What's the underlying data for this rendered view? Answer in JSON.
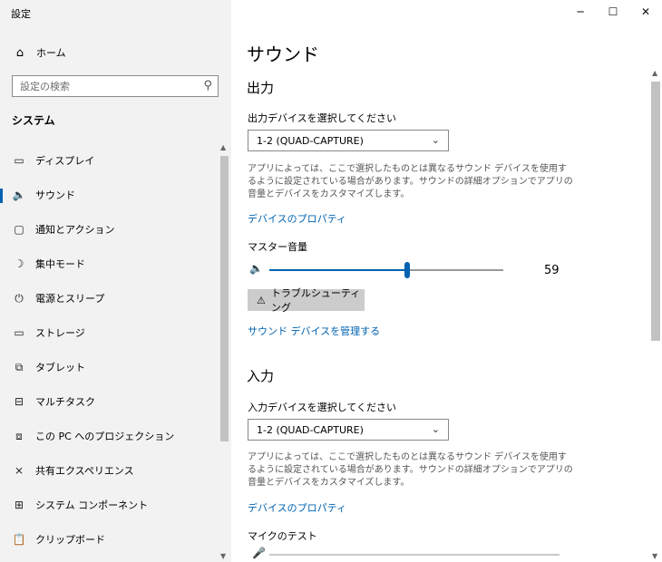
{
  "window": {
    "title": "設定"
  },
  "sidebar": {
    "home_label": "ホーム",
    "search_placeholder": "設定の検索",
    "section_title": "システム",
    "items": [
      {
        "label": "ディスプレイ",
        "icon": "monitor-icon"
      },
      {
        "label": "サウンド",
        "icon": "speaker-icon",
        "active": true
      },
      {
        "label": "通知とアクション",
        "icon": "notification-icon"
      },
      {
        "label": "集中モード",
        "icon": "moon-icon"
      },
      {
        "label": "電源とスリープ",
        "icon": "power-icon"
      },
      {
        "label": "ストレージ",
        "icon": "storage-icon"
      },
      {
        "label": "タブレット",
        "icon": "tablet-icon"
      },
      {
        "label": "マルチタスク",
        "icon": "multitask-icon"
      },
      {
        "label": "この PC へのプロジェクション",
        "icon": "projection-icon"
      },
      {
        "label": "共有エクスペリエンス",
        "icon": "share-icon"
      },
      {
        "label": "システム コンポーネント",
        "icon": "component-icon"
      },
      {
        "label": "クリップボード",
        "icon": "clipboard-icon"
      }
    ]
  },
  "main": {
    "title": "サウンド",
    "output": {
      "heading": "出力",
      "select_label": "出力デバイスを選択してください",
      "device": "1-2 (QUAD-CAPTURE)",
      "description": "アプリによっては、ここで選択したものとは異なるサウンド デバイスを使用するように設定されている場合があります。サウンドの詳細オプションでアプリの音量とデバイスをカスタマイズします。",
      "properties_link": "デバイスのプロパティ",
      "master_volume_label": "マスター音量",
      "volume": 59,
      "troubleshoot_label": "トラブルシューティング",
      "manage_link": "サウンド デバイスを管理する"
    },
    "input": {
      "heading": "入力",
      "select_label": "入力デバイスを選択してください",
      "device": "1-2 (QUAD-CAPTURE)",
      "description": "アプリによっては、ここで選択したものとは異なるサウンド デバイスを使用するように設定されている場合があります。サウンドの詳細オプションでアプリの音量とデバイスをカスタマイズします。",
      "properties_link": "デバイスのプロパティ",
      "mic_test_label": "マイクのテスト"
    }
  },
  "colors": {
    "accent": "#0063b1",
    "sidebar_bg": "#f2f2f2"
  }
}
